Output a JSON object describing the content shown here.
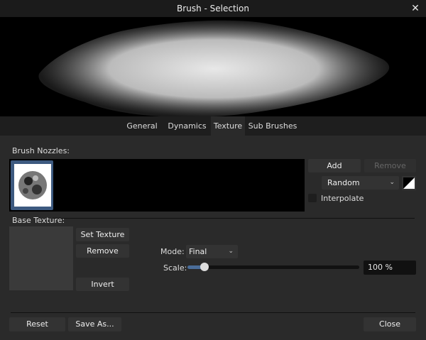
{
  "window": {
    "title": "Brush - Selection",
    "close_icon": "close-icon"
  },
  "tabs": [
    {
      "label": "General"
    },
    {
      "label": "Dynamics"
    },
    {
      "label": "Texture",
      "active": true
    },
    {
      "label": "Sub Brushes"
    }
  ],
  "nozzles": {
    "label": "Brush Nozzles:",
    "add": "Add",
    "remove": "Remove",
    "order": "Random",
    "interpolate": "Interpolate",
    "interpolate_checked": false
  },
  "base_texture": {
    "label": "Base Texture:",
    "set_texture": "Set Texture",
    "remove": "Remove",
    "invert": "Invert",
    "mode_label": "Mode:",
    "mode_value": "Final",
    "scale_label": "Scale:",
    "scale_value": "100 %",
    "scale_slider_fraction": 0.1
  },
  "footer": {
    "reset": "Reset",
    "save_as": "Save As...",
    "close": "Close"
  },
  "colors": {
    "accent": "#3d5a80",
    "slider_fill": "#4a6d99"
  }
}
